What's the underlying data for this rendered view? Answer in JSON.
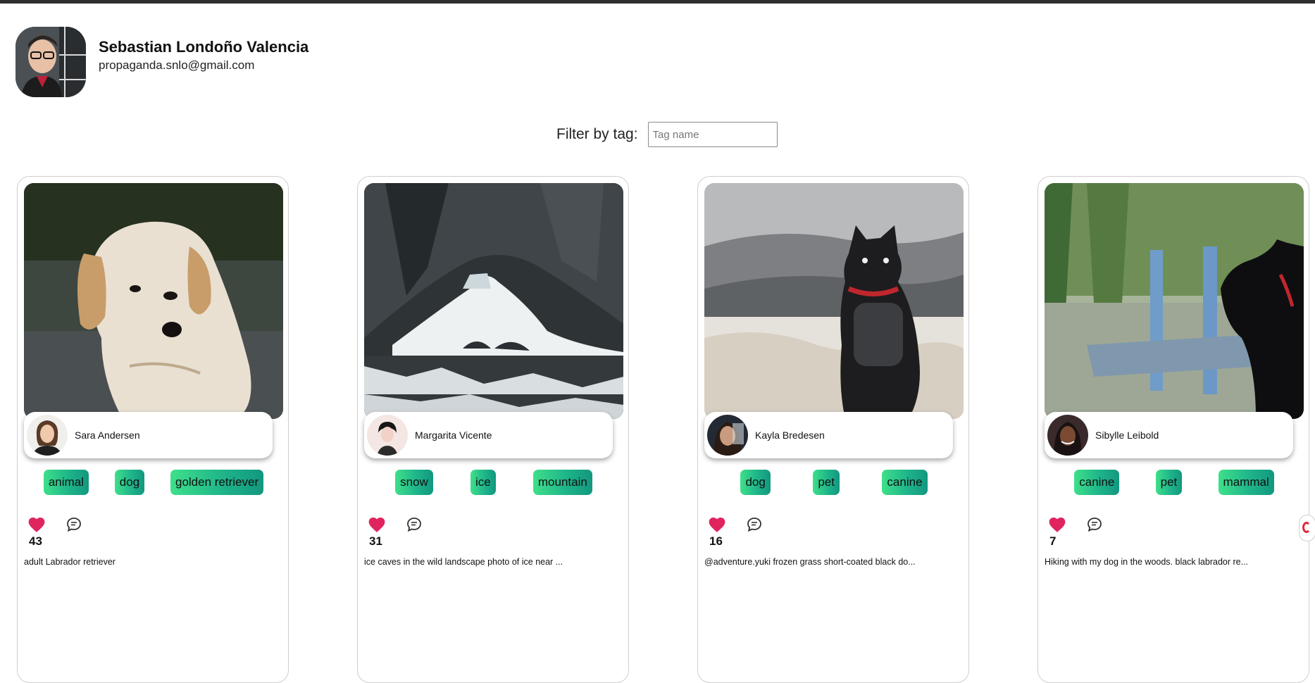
{
  "colors": {
    "top_bar": "#2f2f2f",
    "tag_gradient_start": "#3ee08a",
    "tag_gradient_end": "#12977f",
    "like_heart": "#e0245e"
  },
  "profile": {
    "name": "Sebastian Londoño Valencia",
    "email": "propaganda.snlo@gmail.com"
  },
  "filter": {
    "label": "Filter by tag:",
    "placeholder": "Tag name",
    "value": ""
  },
  "posts": [
    {
      "author": "Sara Andersen",
      "tags": [
        "animal",
        "dog",
        "golden retriever"
      ],
      "likes": "43",
      "caption": "adult Labrador retriever",
      "icons": [
        "heart-icon",
        "comment-icon"
      ]
    },
    {
      "author": "Margarita Vicente",
      "tags": [
        "snow",
        "ice",
        "mountain"
      ],
      "likes": "31",
      "caption": "ice caves in the wild landscape photo of ice near ...",
      "icons": [
        "heart-icon",
        "comment-icon"
      ]
    },
    {
      "author": "Kayla Bredesen",
      "tags": [
        "dog",
        "pet",
        "canine"
      ],
      "likes": "16",
      "caption": "@adventure.yuki frozen grass short-coated black do...",
      "icons": [
        "heart-icon",
        "comment-icon"
      ]
    },
    {
      "author": "Sibylle Leibold",
      "tags": [
        "canine",
        "pet",
        "mammal"
      ],
      "likes": "7",
      "caption": "Hiking with my dog in the woods. black labrador re...",
      "icons": [
        "heart-icon",
        "comment-icon"
      ]
    }
  ]
}
